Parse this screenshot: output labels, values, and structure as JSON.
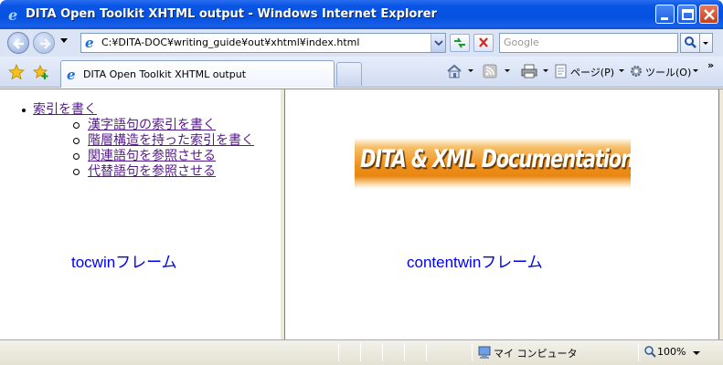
{
  "window": {
    "title": "DITA Open Toolkit XHTML output - Windows Internet Explorer"
  },
  "address": {
    "url": "C:¥DITA-DOC¥writing_guide¥out¥xhtml¥index.html"
  },
  "search": {
    "placeholder": "Google"
  },
  "tab": {
    "label": "DITA Open Toolkit XHTML output"
  },
  "commands": {
    "page_label": "ページ(P)",
    "tools_label": "ツール(O)",
    "more": "»"
  },
  "toc": {
    "top_item": "索引を書く",
    "sub_items": [
      "漢字語句の索引を書く",
      "階層構造を持った索引を書く",
      "関連語句を参照させる",
      "代替語句を参照させる"
    ]
  },
  "frames": {
    "left_label": "tocwinフレーム",
    "right_label": "contentwinフレーム"
  },
  "banner": {
    "text": "DITA & XML Documentation",
    "color": "#ef8f1a"
  },
  "status": {
    "zone": "マイ コンピュータ",
    "zoom": "100%"
  }
}
